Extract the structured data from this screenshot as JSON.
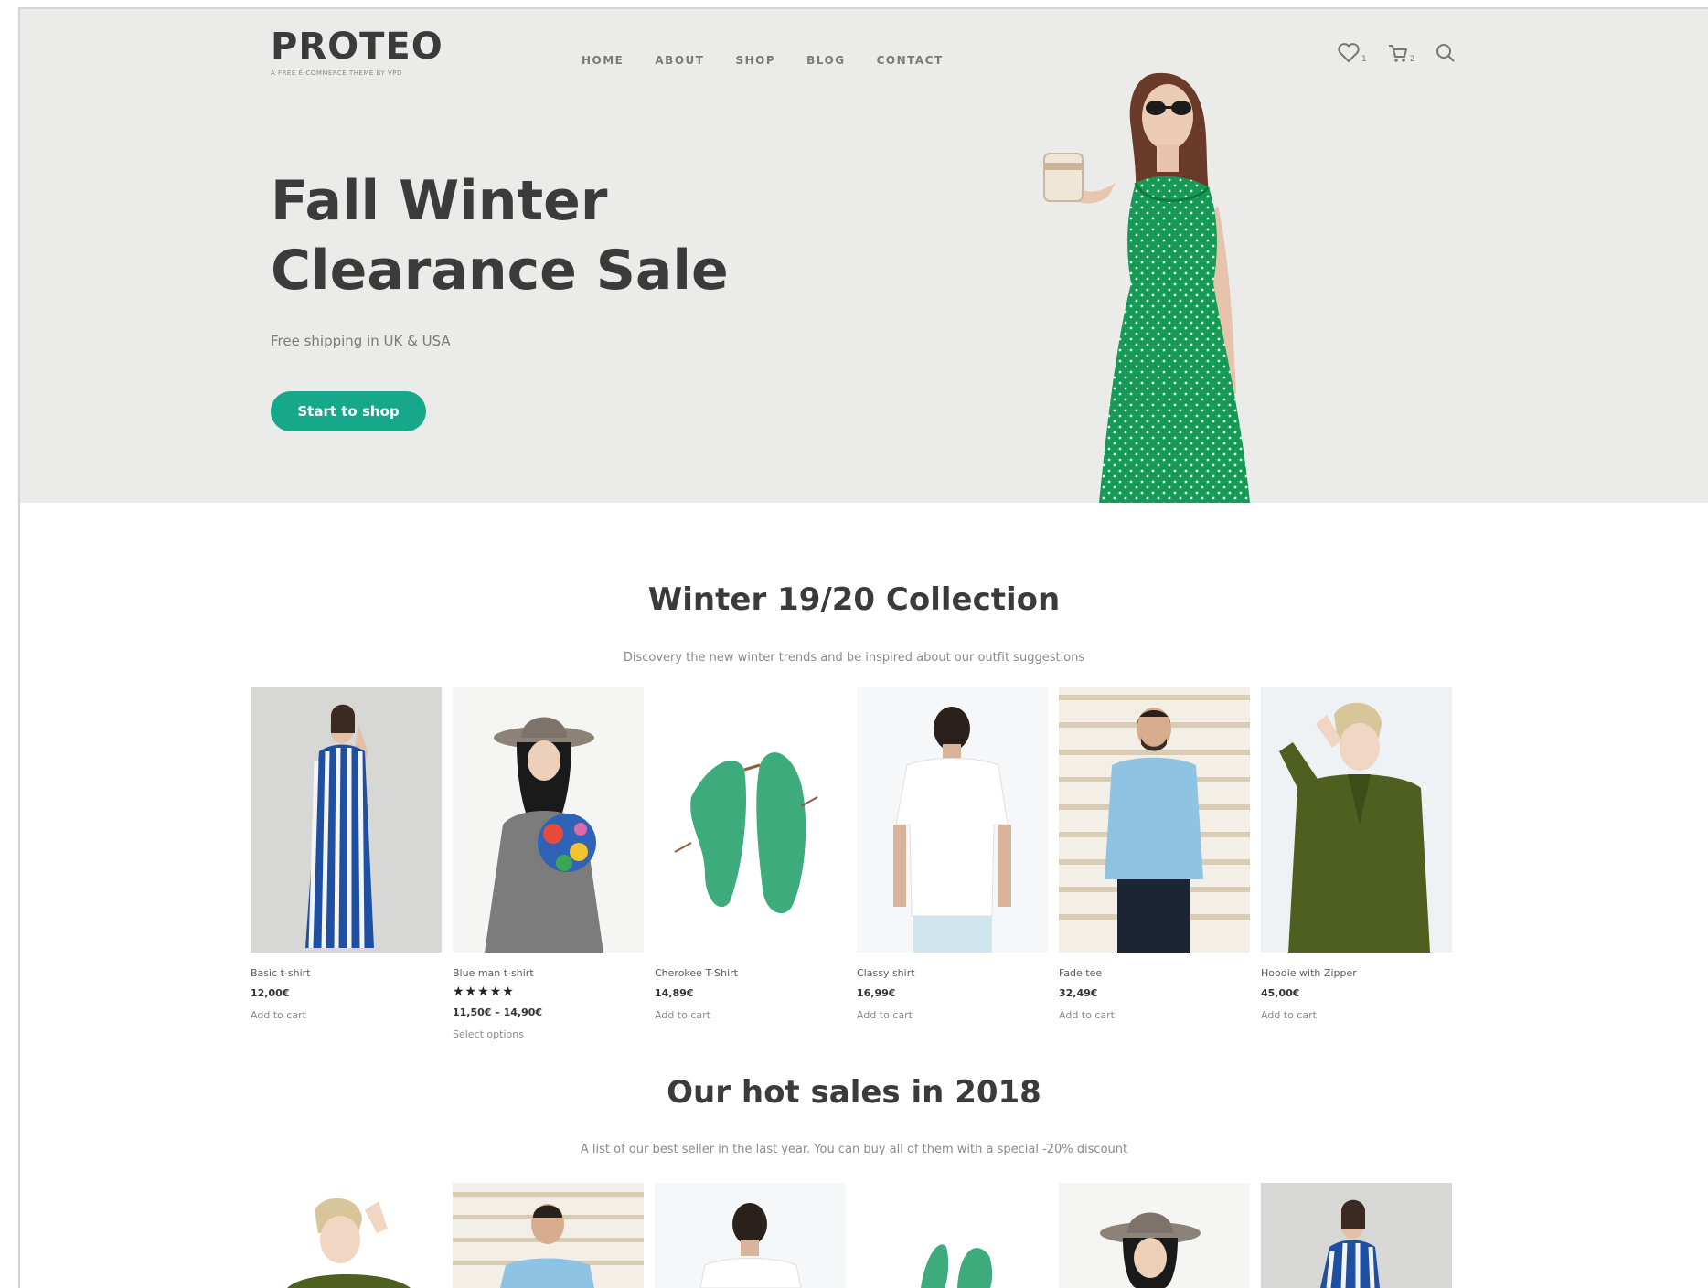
{
  "brand": {
    "name": "PROTEO",
    "tagline": "A FREE E-COMMERCE THEME BY VPD"
  },
  "nav": {
    "items": [
      "HOME",
      "ABOUT",
      "SHOP",
      "BLOG",
      "CONTACT"
    ]
  },
  "header_icons": {
    "wishlist": {
      "icon": "heart-icon",
      "count": "1"
    },
    "cart": {
      "icon": "cart-icon",
      "count": "2"
    },
    "search": {
      "icon": "search-icon"
    }
  },
  "hero": {
    "title_line1": "Fall Winter",
    "title_line2": "Clearance Sale",
    "subtitle": "Free shipping in UK & USA",
    "button": "Start to shop"
  },
  "collection": {
    "title": "Winter 19/20 Collection",
    "subtitle": "Discovery the new winter trends and be inspired about our outfit suggestions",
    "products": [
      {
        "name": "Basic t-shirt",
        "rating": "",
        "price": "12,00€",
        "action": "Add to cart"
      },
      {
        "name": "Blue man t-shirt",
        "rating": "★★★★★",
        "price": "11,50€ – 14,90€",
        "action": "Select options"
      },
      {
        "name": "Cherokee T-Shirt",
        "rating": "",
        "price": "14,89€",
        "action": "Add to cart"
      },
      {
        "name": "Classy shirt",
        "rating": "",
        "price": "16,99€",
        "action": "Add to cart"
      },
      {
        "name": "Fade tee",
        "rating": "",
        "price": "32,49€",
        "action": "Add to cart"
      },
      {
        "name": "Hoodie with Zipper",
        "rating": "",
        "price": "45,00€",
        "action": "Add to cart"
      }
    ]
  },
  "hot_sales": {
    "title": "Our hot sales in 2018",
    "subtitle": "A list of our best seller in the last year. You can buy all of them with a special -20% discount"
  },
  "colors": {
    "accent": "#17a88b",
    "hero_bg": "#ebebe9",
    "text_dark": "#3b3b3b"
  }
}
